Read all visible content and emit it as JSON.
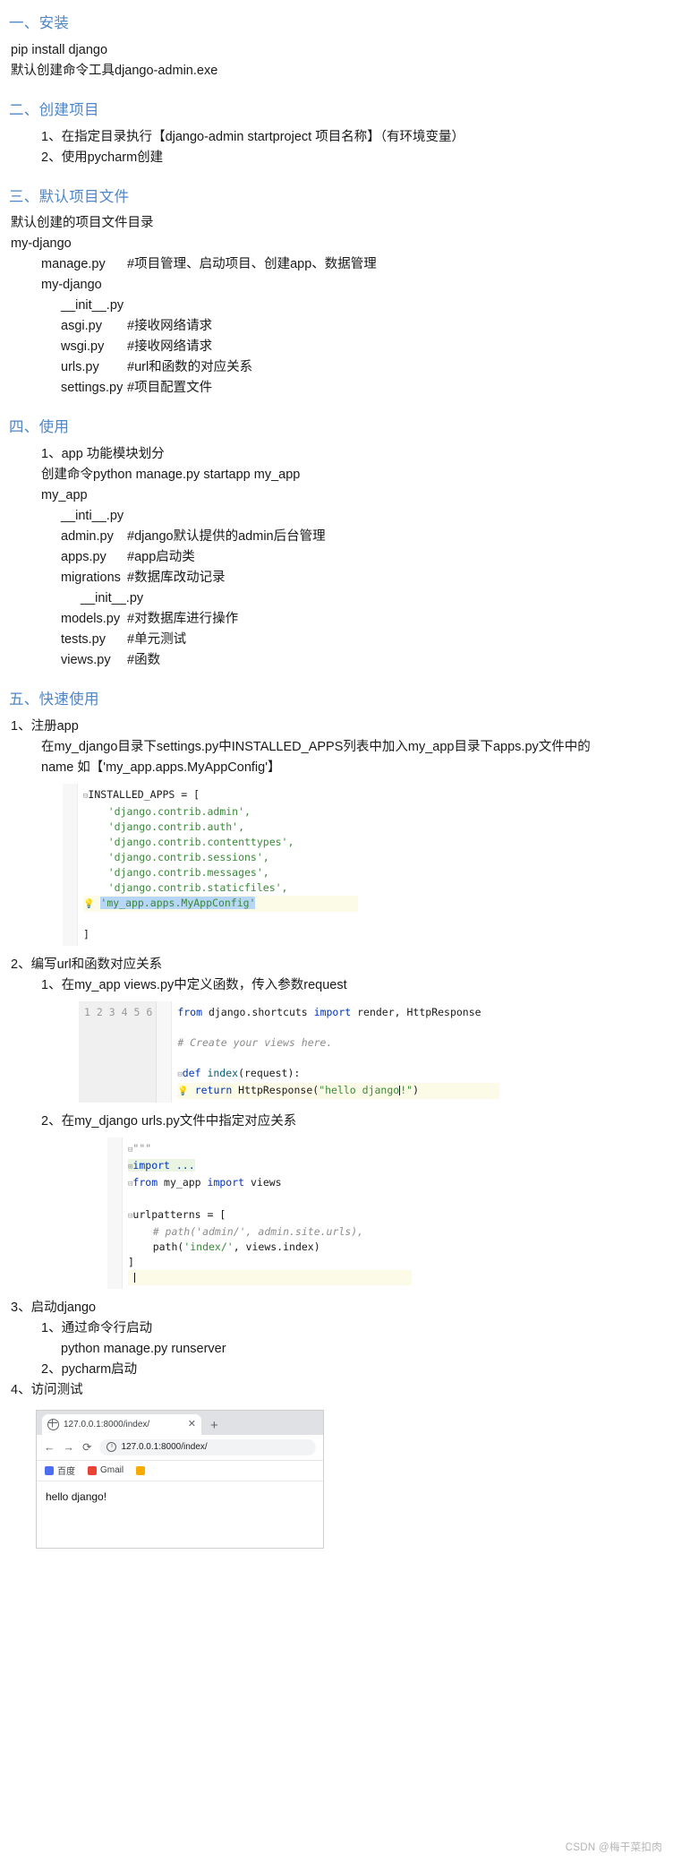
{
  "sections": [
    {
      "heading": "一、安装",
      "lines": [
        {
          "text": "pip install django",
          "indent": 0
        },
        {
          "text": "默认创建命令工具django-admin.exe",
          "indent": 0
        }
      ]
    },
    {
      "heading": "二、创建项目",
      "lines": [
        {
          "text": "1、在指定目录执行【django-admin startproject 项目名称】（有环境变量）",
          "indent": 1
        },
        {
          "text": "2、使用pycharm创建",
          "indent": 1
        }
      ]
    },
    {
      "heading": "三、默认项目文件",
      "lines": [
        {
          "text": "默认创建的项目文件目录",
          "indent": 0
        },
        {
          "text": "my-django",
          "indent": 0
        },
        {
          "name": "manage.py",
          "comment": "#项目管理、启动项目、创建app、数据管理",
          "indent": 1
        },
        {
          "text": "my-django",
          "indent": 1
        },
        {
          "text": "__init__.py",
          "indent": 2
        },
        {
          "name": "asgi.py",
          "comment": "#接收网络请求",
          "indent": 2
        },
        {
          "name": "wsgi.py",
          "comment": "#接收网络请求",
          "indent": 2
        },
        {
          "name": "urls.py",
          "comment": "#url和函数的对应关系",
          "indent": 2
        },
        {
          "name": "settings.py",
          "comment": "#项目配置文件",
          "indent": 2
        }
      ]
    },
    {
      "heading": "四、使用",
      "lines": [
        {
          "text": "1、app 功能模块划分",
          "indent": 1
        },
        {
          "text": "创建命令python manage.py startapp my_app",
          "indent": 1
        },
        {
          "text": "my_app",
          "indent": 1
        },
        {
          "text": "__inti__.py",
          "indent": 2
        },
        {
          "name": "admin.py",
          "comment": "#django默认提供的admin后台管理",
          "indent": 2
        },
        {
          "name": "apps.py",
          "comment": "#app启动类",
          "indent": 2
        },
        {
          "name": "migrations",
          "comment": "#数据库改动记录",
          "indent": 2
        },
        {
          "text": "__init__.py",
          "indent": 3
        },
        {
          "name": "models.py",
          "comment": "#对数据库进行操作",
          "indent": 2
        },
        {
          "name": "tests.py",
          "comment": "#单元测试",
          "indent": 2
        },
        {
          "name": "views.py",
          "comment": "#函数",
          "indent": 2
        }
      ]
    }
  ],
  "section5": {
    "heading": "五、快速使用",
    "step1": {
      "title": "1、注册app",
      "body_line1": "在my_django目录下settings.py中INSTALLED_APPS列表中加入my_app目录下apps.py文件中的",
      "body_line2": "name 如【'my_app.apps.MyAppConfig'】",
      "code": {
        "lines": [
          "INSTALLED_APPS = [",
          "    'django.contrib.admin',",
          "    'django.contrib.auth',",
          "    'django.contrib.contenttypes',",
          "    'django.contrib.sessions',",
          "    'django.contrib.messages',",
          "    'django.contrib.staticfiles',",
          "    'my_app.apps.MyAppConfig'",
          "]"
        ],
        "selected_line": "'my_app.apps.MyAppConfig'"
      }
    },
    "step2": {
      "title": "2、编写url和函数对应关系",
      "sub1": {
        "title": "1、在my_app views.py中定义函数，传入参数request",
        "gutter": [
          "1",
          "2",
          "3",
          "4",
          "5",
          "6"
        ],
        "code": [
          "from django.shortcuts import render, HttpResponse",
          "",
          "# Create your views here.",
          "",
          "def index(request):",
          "    return HttpResponse(\"hello django!\")"
        ]
      },
      "sub2": {
        "title": "2、在my_django urls.py文件中指定对应关系",
        "code": [
          "\"\"\"",
          "import ...",
          "from my_app import views",
          "",
          "urlpatterns = [",
          "    # path('admin/', admin.site.urls),",
          "    path('index/', views.index)",
          "]",
          ""
        ]
      }
    },
    "step3": {
      "title": "3、启动django",
      "items": [
        {
          "text": "1、通过命令行启动",
          "indent": 1
        },
        {
          "text": "python manage.py runserver",
          "indent": 2
        },
        {
          "text": "2、pycharm启动",
          "indent": 1
        }
      ]
    },
    "step4": {
      "title": "4、访问测试"
    }
  },
  "browser": {
    "tab_title": "127.0.0.1:8000/index/",
    "tab_close": "✕",
    "new_tab": "+",
    "nav_back": "←",
    "nav_forward": "→",
    "nav_reload": "⟳",
    "info_icon": "i",
    "url": "127.0.0.1:8000/index/",
    "bookmarks": [
      {
        "label": "百度",
        "color": "#4e6ef2"
      },
      {
        "label": "Gmail",
        "color": "#ea4335"
      },
      {
        "label": "",
        "color": "#f9ab00"
      }
    ],
    "page_text": "hello django!"
  },
  "watermark": "CSDN @梅干菜扣肉",
  "colors": {
    "heading": "#4f86c6",
    "text": "#1a1a1a",
    "string": "#3a8a3a",
    "keyword": "#0033b3",
    "comment": "#8c8c8c",
    "selection": "#b8d6f5",
    "highlight_row": "#fcfbe8"
  }
}
